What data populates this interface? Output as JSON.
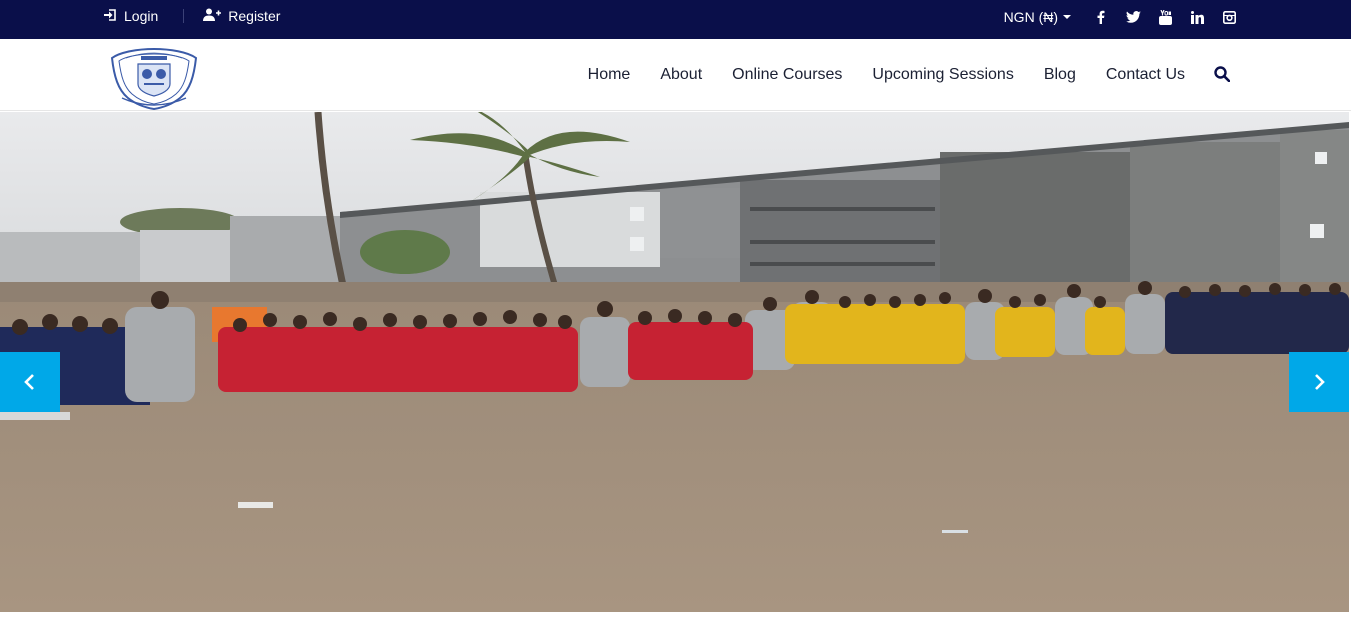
{
  "topbar": {
    "login_label": "Login",
    "register_label": "Register",
    "currency_label": "NGN (₦)",
    "social": [
      "facebook-icon",
      "twitter-icon",
      "youtube-icon",
      "linkedin-icon",
      "instagram-icon"
    ]
  },
  "header": {
    "logo_alt": "PREPARATORY",
    "nav": [
      "Home",
      "About",
      "Online Courses",
      "Upcoming Sessions",
      "Blog",
      "Contact Us"
    ],
    "search_icon": "search-icon"
  },
  "hero": {
    "prev_icon": "chevron-left-icon",
    "next_icon": "chevron-right-icon",
    "image_alt": "Pupils in uniforms lined up on a sandy school field in front of apartment blocks"
  },
  "colors": {
    "topbar": "#0a0f4a",
    "accent": "#00a8e8",
    "nav_text": "#1b2033"
  }
}
